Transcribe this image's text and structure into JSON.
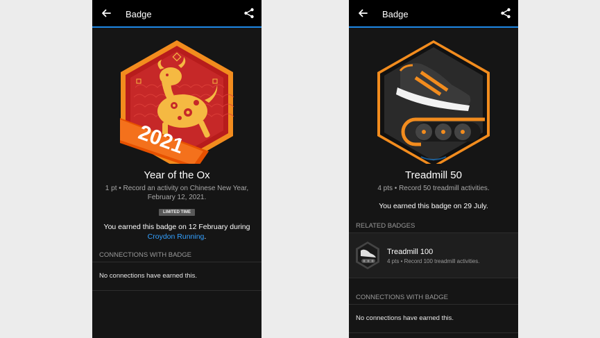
{
  "left": {
    "appbar_title": "Badge",
    "badge": {
      "year_text": "2021",
      "name": "Year of the Ox",
      "description": "1 pt • Record an activity on Chinese New Year, February 12, 2021.",
      "chip": "LIMITED TIME",
      "earned_prefix": "You earned this badge on 12 February during",
      "earned_link": "Croydon Running",
      "earned_suffix": "."
    },
    "connections": {
      "header": "CONNECTIONS WITH BADGE",
      "empty": "No connections have earned this."
    }
  },
  "right": {
    "appbar_title": "Badge",
    "badge": {
      "name": "Treadmill 50",
      "description": "4 pts • Record 50 treadmill activities.",
      "earned": "You earned this badge on 29 July."
    },
    "related": {
      "header": "RELATED BADGES",
      "items": [
        {
          "name": "Treadmill 100",
          "description": "4 pts • Record 100 treadmill activities."
        }
      ]
    },
    "connections": {
      "header": "CONNECTIONS WITH BADGE",
      "empty": "No connections have earned this."
    }
  },
  "colors": {
    "accent": "#1e88e5",
    "link": "#33a0ff",
    "badge_orange": "#f28c1e",
    "ox_red": "#c62828",
    "gold": "#f5b942"
  }
}
